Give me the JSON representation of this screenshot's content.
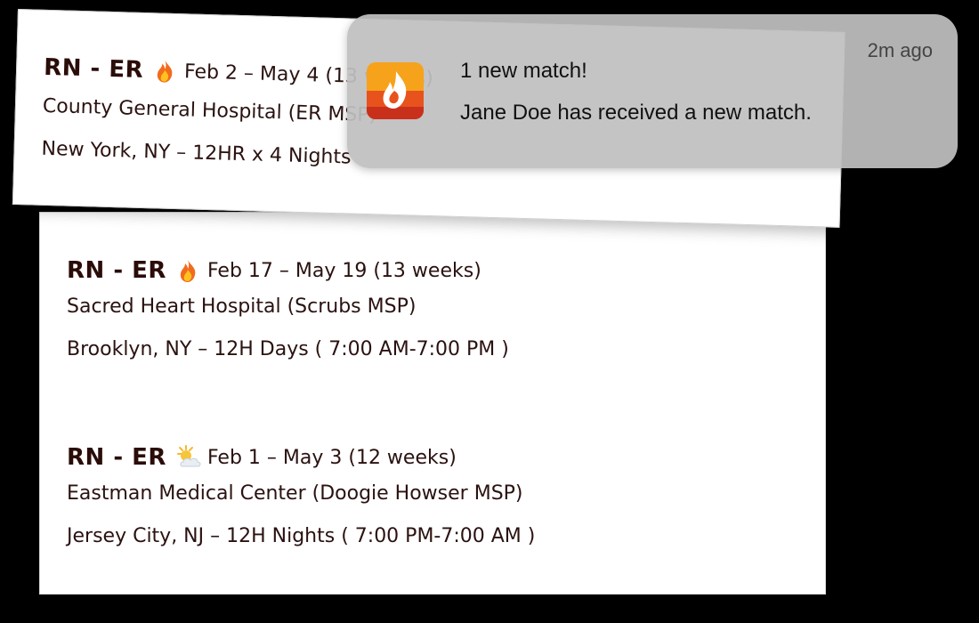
{
  "notification": {
    "app_icon": "flame-app-icon",
    "title": "1 new match!",
    "body": "Jane Doe has received a new match.",
    "time": "2m ago"
  },
  "jobs": [
    {
      "role": "RN - ER",
      "icon": "fire-icon",
      "dates": "Feb 2 – May 4 (13 weeks)",
      "facility": "County General Hospital (ER MSP)",
      "location": "New York, NY – 12HR x 4 Nights"
    },
    {
      "role": "RN - ER",
      "icon": "fire-icon",
      "dates": "Feb 17 – May 19 (13 weeks)",
      "facility": "Sacred Heart Hospital (Scrubs MSP)",
      "location": "Brooklyn, NY – 12H Days ( 7:00 AM-7:00 PM )"
    },
    {
      "role": "RN - ER",
      "icon": "sun-cloud-icon",
      "dates": "Feb 1 – May 3 (12 weeks)",
      "facility": "Eastman Medical Center (Doogie Howser MSP)",
      "location": "Jersey City, NJ – 12H Nights ( 7:00 PM-7:00 AM )"
    }
  ]
}
